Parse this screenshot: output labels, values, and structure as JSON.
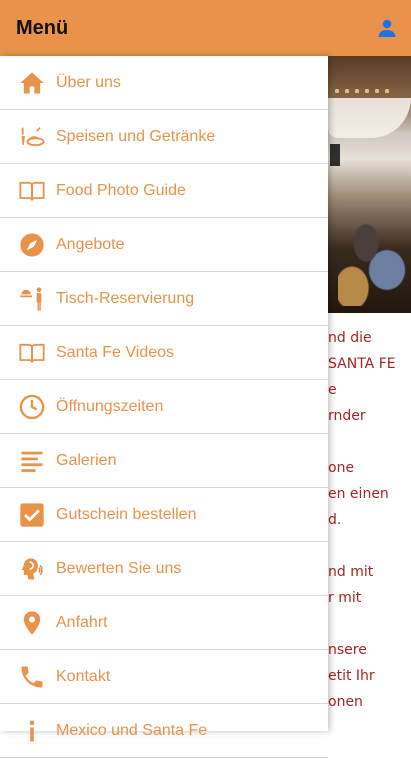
{
  "header": {
    "title": "Menü"
  },
  "accent": "#e8924a",
  "text_red": "#a72424",
  "menu": [
    {
      "label": "Über uns",
      "icon": "home-icon"
    },
    {
      "label": "Speisen und Getränke",
      "icon": "food-drink-icon"
    },
    {
      "label": "Food Photo Guide",
      "icon": "book-icon"
    },
    {
      "label": "Angebote",
      "icon": "compass-icon"
    },
    {
      "label": "Tisch-Reservierung",
      "icon": "waiter-icon"
    },
    {
      "label": "Santa Fe Videos",
      "icon": "book-icon"
    },
    {
      "label": "Öffnungszeiten",
      "icon": "clock-icon"
    },
    {
      "label": "Galerien",
      "icon": "lines-icon"
    },
    {
      "label": "Gutschein bestellen",
      "icon": "checkbox-icon"
    },
    {
      "label": "Bewerten Sie uns",
      "icon": "rating-icon"
    },
    {
      "label": "Anfahrt",
      "icon": "location-pin-icon"
    },
    {
      "label": "Kontakt",
      "icon": "phone-icon"
    },
    {
      "label": "Mexico und Santa Fe",
      "icon": "info-icon"
    }
  ],
  "background_text": [
    "nd die",
    "SANTA FE",
    "e",
    "rnder",
    "",
    "one",
    "en einen",
    "d.",
    "",
    "nd mit",
    "r mit",
    "",
    "nsere",
    "etit Ihr",
    "onen"
  ]
}
